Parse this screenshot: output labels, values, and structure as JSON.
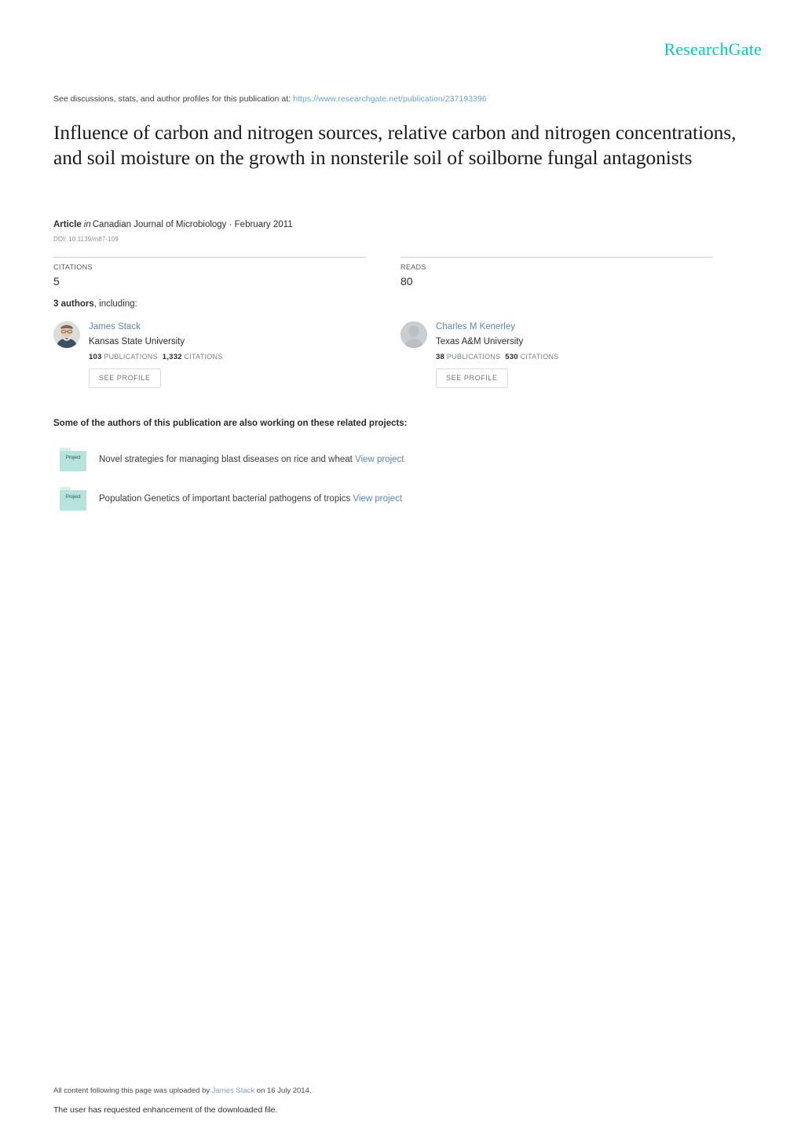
{
  "brand": {
    "name": "ResearchGate",
    "color": "#00d0b0"
  },
  "discussion": {
    "prefix": "See discussions, stats, and author profiles for this publication at:",
    "url": "https://www.researchgate.net/publication/237193396"
  },
  "publication": {
    "title": "Influence of carbon and nitrogen sources, relative carbon and nitrogen concentrations, and soil moisture on the growth in nonsterile soil of soilborne fungal antagonists",
    "kind": "Article",
    "in_word": "in",
    "venue": "Canadian Journal of Microbiology · February 2011",
    "doi": "DOI: 10.1139/m87-109"
  },
  "stats": {
    "citations": {
      "label": "CITATIONS",
      "value": "5"
    },
    "reads": {
      "label": "READS",
      "value": "80"
    }
  },
  "authors_header": {
    "count": "3 authors",
    "suffix": ", including:"
  },
  "authors": [
    {
      "name": "James Stack",
      "affiliation": "Kansas State University",
      "publications": "103",
      "publications_label": "PUBLICATIONS",
      "citations": "1,332",
      "citations_label": "CITATIONS",
      "button": "SEE PROFILE",
      "avatar": "photo-avatar"
    },
    {
      "name": "Charles M Kenerley",
      "affiliation": "Texas A&M University",
      "publications": "38",
      "publications_label": "PUBLICATIONS",
      "citations": "530",
      "citations_label": "CITATIONS",
      "button": "SEE PROFILE",
      "avatar": "placeholder-avatar"
    }
  ],
  "projects": {
    "header": "Some of the authors of this publication are also working on these related projects:",
    "icon_label": "Project",
    "items": [
      {
        "title": "Novel strategies for managing blast diseases on rice and wheat",
        "link": "View project"
      },
      {
        "title": "Population Genetics of important bacterial pathogens of tropics",
        "link": "View project"
      }
    ]
  },
  "footer": {
    "upload_prefix": "All content following this page was uploaded by ",
    "upload_author": "James Stack",
    "upload_suffix": " on 16 July 2014.",
    "enhancement": "The user has requested enhancement of the downloaded file."
  }
}
